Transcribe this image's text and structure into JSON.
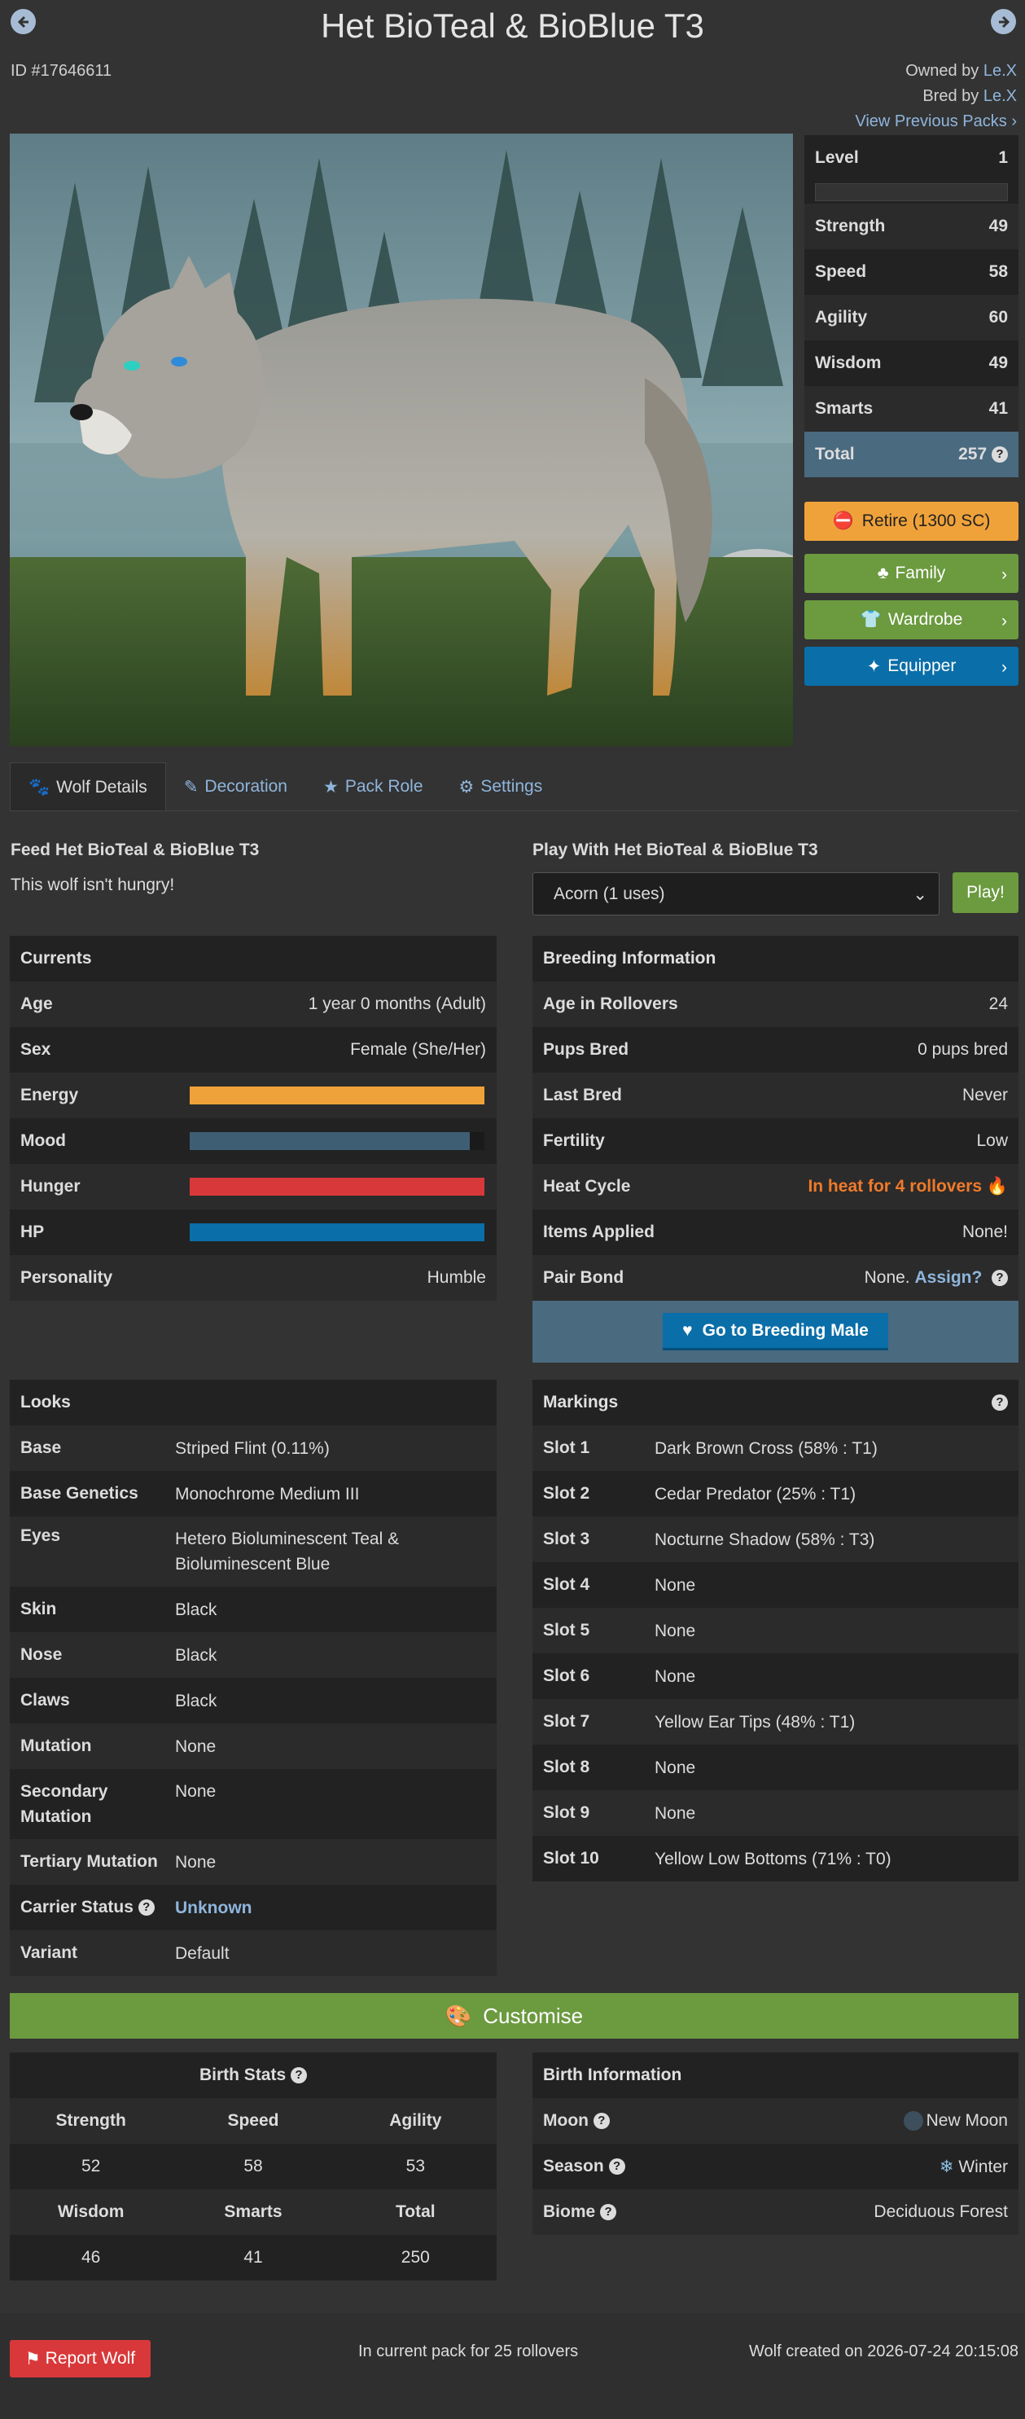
{
  "header": {
    "title": "Het BioTeal & BioBlue T3",
    "id": "ID #17646611",
    "owned_prefix": "Owned by",
    "owner": "Le.X",
    "bred_prefix": "Bred by",
    "breeder": "Le.X",
    "view_packs": "View Previous Packs"
  },
  "stats": {
    "level_label": "Level",
    "level": "1",
    "rows": [
      {
        "label": "Strength",
        "value": "49"
      },
      {
        "label": "Speed",
        "value": "58"
      },
      {
        "label": "Agility",
        "value": "60"
      },
      {
        "label": "Wisdom",
        "value": "49"
      },
      {
        "label": "Smarts",
        "value": "41"
      }
    ],
    "total_label": "Total",
    "total": "257",
    "xp_fraction": 0
  },
  "side_buttons": {
    "retire": "Retire (1300 SC)",
    "family": "Family",
    "wardrobe": "Wardrobe",
    "equipper": "Equipper"
  },
  "tabs": [
    "Wolf Details",
    "Decoration",
    "Pack Role",
    "Settings"
  ],
  "feed": {
    "title": "Feed Het BioTeal & BioBlue T3",
    "status": "This wolf isn't hungry!"
  },
  "play": {
    "title": "Play With Het BioTeal & BioBlue T3",
    "selected": "Acorn (1 uses)",
    "button": "Play!"
  },
  "currents": {
    "title": "Currents",
    "age_label": "Age",
    "age": "1 year 0 months (Adult)",
    "sex_label": "Sex",
    "sex": "Female (She/Her)",
    "energy_label": "Energy",
    "energy": 1.0,
    "mood_label": "Mood",
    "mood": 0.95,
    "hunger_label": "Hunger",
    "hunger": 1.0,
    "hp_label": "HP",
    "hp": 1.0,
    "personality_label": "Personality",
    "personality": "Humble",
    "colors": {
      "energy": "#f0a23a",
      "mood": "#3e5f73",
      "hunger": "#d9383a",
      "hp": "#0a6ea8"
    }
  },
  "breeding": {
    "title": "Breeding Information",
    "rows": [
      {
        "label": "Age in Rollovers",
        "value": "24"
      },
      {
        "label": "Pups Bred",
        "value": "0 pups bred"
      },
      {
        "label": "Last Bred",
        "value": "Never"
      },
      {
        "label": "Fertility",
        "value": "Low"
      }
    ],
    "heat_label": "Heat Cycle",
    "heat": "In heat for 4 rollovers",
    "items_label": "Items Applied",
    "items": "None!",
    "pair_label": "Pair Bond",
    "pair": "None.",
    "assign": "Assign?",
    "go_button": "Go to Breeding Male"
  },
  "looks": {
    "title": "Looks",
    "rows": [
      {
        "label": "Base",
        "value": "Striped Flint (0.11%)"
      },
      {
        "label": "Base Genetics",
        "value": "Monochrome Medium III"
      },
      {
        "label": "Eyes",
        "value": "Hetero Bioluminescent Teal & Bioluminescent Blue"
      },
      {
        "label": "Skin",
        "value": "Black"
      },
      {
        "label": "Nose",
        "value": "Black"
      },
      {
        "label": "Claws",
        "value": "Black"
      },
      {
        "label": "Mutation",
        "value": "None"
      },
      {
        "label": "Secondary Mutation",
        "value": "None"
      },
      {
        "label": "Tertiary Mutation",
        "value": "None"
      },
      {
        "label": "Carrier Status",
        "value": "Unknown"
      },
      {
        "label": "Variant",
        "value": "Default"
      }
    ]
  },
  "markings": {
    "title": "Markings",
    "rows": [
      {
        "label": "Slot 1",
        "value": "Dark Brown Cross (58% : T1)"
      },
      {
        "label": "Slot 2",
        "value": "Cedar Predator (25% : T1)"
      },
      {
        "label": "Slot 3",
        "value": "Nocturne Shadow (58% : T3)"
      },
      {
        "label": "Slot 4",
        "value": "None"
      },
      {
        "label": "Slot 5",
        "value": "None"
      },
      {
        "label": "Slot 6",
        "value": "None"
      },
      {
        "label": "Slot 7",
        "value": "Yellow Ear Tips (48% : T1)"
      },
      {
        "label": "Slot 8",
        "value": "None"
      },
      {
        "label": "Slot 9",
        "value": "None"
      },
      {
        "label": "Slot 10",
        "value": "Yellow Low Bottoms (71% : T0)"
      }
    ]
  },
  "customise": "Customise",
  "birth_stats": {
    "title": "Birth Stats",
    "h1": [
      "Strength",
      "Speed",
      "Agility"
    ],
    "v1": [
      "52",
      "58",
      "53"
    ],
    "h2": [
      "Wisdom",
      "Smarts",
      "Total"
    ],
    "v2": [
      "46",
      "41",
      "250"
    ]
  },
  "birth_info": {
    "title": "Birth Information",
    "moon_label": "Moon",
    "moon": "New Moon",
    "season_label": "Season",
    "season": "Winter",
    "biome_label": "Biome",
    "biome": "Deciduous Forest"
  },
  "footer": {
    "report": "Report Wolf",
    "pack_time": "In current pack for 25 rollovers",
    "created": "Wolf created on 2026-07-24 20:15:08"
  }
}
